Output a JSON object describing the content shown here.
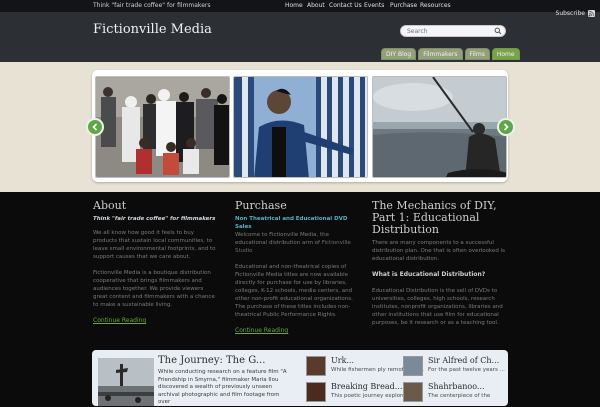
{
  "topbar": {
    "tagline": "Think \"fair trade coffee\" for filmmakers",
    "nav": [
      "Home",
      "About",
      "Contact Us",
      "Events",
      "Purchase",
      "Resources"
    ],
    "subscribe": "Subscribe"
  },
  "header": {
    "title": "Fictionville Media",
    "search_placeholder": "Search",
    "tabs": [
      "DIY Blog",
      "Filmmakers",
      "Films",
      "Home"
    ]
  },
  "columns": {
    "about": {
      "title": "About",
      "subtitle": "Think \"fair trade coffee\" for filmmakers",
      "p1": "We all know how good it feels to buy products that sustain local communities, to leave small environmental footprints, and to support causes that we care about.",
      "p2": "Fictionville Media is a boutique distribution cooperative that brings filmmakers and audiences together.  We provide viewers great content and filmmakers with a chance to make a sustainable living.",
      "link": "Continue Reading"
    },
    "purchase": {
      "title": "Purchase",
      "subtitle": "Non Theatrical and Educational DVD Sales",
      "p1a": "Welcome to Fictionville Media, the educational distribution arm of ",
      "p1b": "Fictionville Studio",
      "p2": "Educational and non-theatrical copies of Fictionville Media titles are now available directly for purchase for use by libraries, colleges, K-12 schools, media centers, and other non-profit educational organizations. The purchase of these titles includes non-theatrical Public Performance Rights.",
      "link": "Continue Reading"
    },
    "diy": {
      "title": "The Mechanics of DIY, Part 1: Educational Distribution",
      "p1": "There are many components to a successful distribution plan.  One that is often overlooked is educational distribution.",
      "q": "What is Educational Distribution?",
      "p2": "Educational Distribution is the sell of DVDs to universities, colleges, high schools, research institutes, nonprofit organizations, libraries and other institutions that use film for educational purposes, be it research or as a teaching tool."
    }
  },
  "bottom": {
    "feature": {
      "title": "The Journey: The G...",
      "text": "While conducting research on a feature film \"A Friendship in Smyrna,\" filmmaker Maria Ilou discovered a wealth of previously unseen archival photographic and film footage from over"
    },
    "items": [
      {
        "title": "Urk...",
        "sub": "While fishermen ply remote sea..."
      },
      {
        "title": "Sir Alfred of Ch...",
        "sub": "For the past twelve years ..."
      },
      {
        "title": "Breaking Bread...",
        "sub": "This poetic journey explores"
      },
      {
        "title": "Shahrbanoo...",
        "sub": "The centerpiece of the"
      }
    ]
  }
}
